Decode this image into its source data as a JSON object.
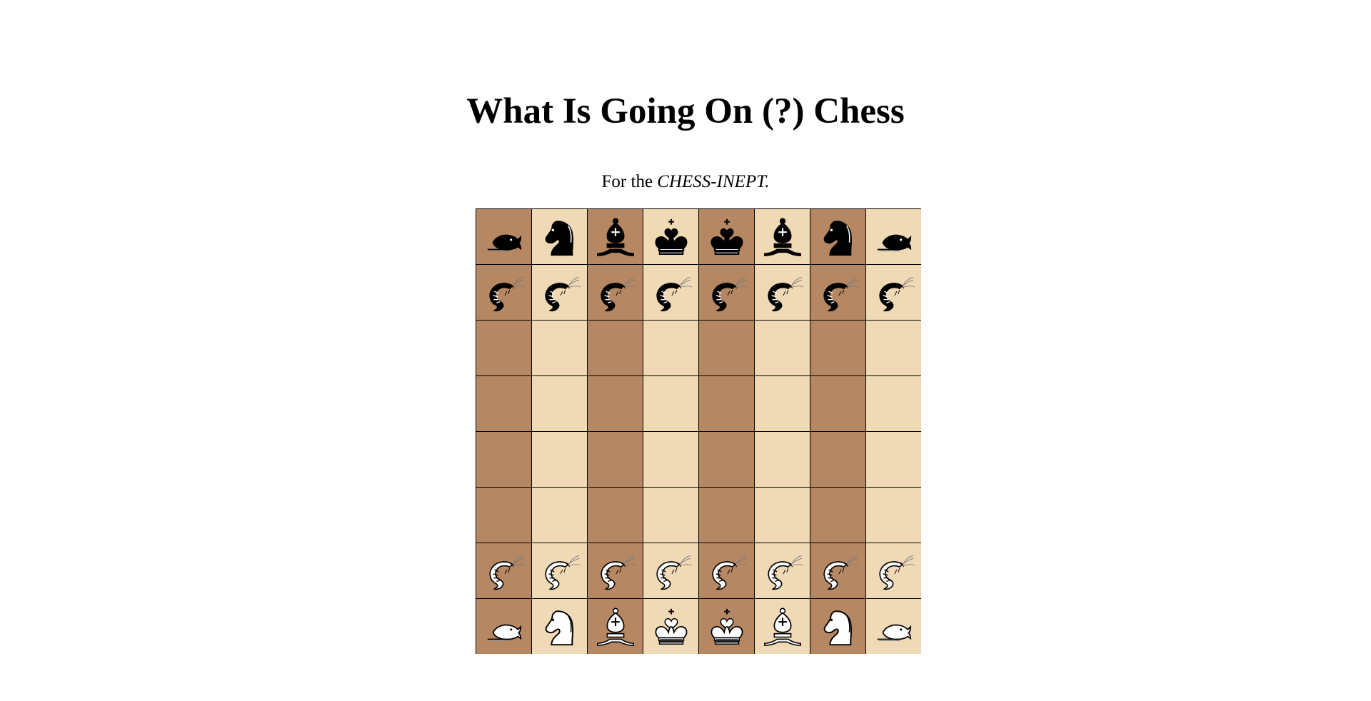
{
  "page": {
    "title": "What Is Going On (?) Chess",
    "subtitle_prefix": "For the ",
    "subtitle_emphasis": "CHESS-INEPT."
  },
  "colors": {
    "light_square": "#f0d9b5",
    "dark_square": "#b58863",
    "grid_line": "#000000"
  },
  "board": {
    "square_colors": [
      [
        "dark",
        "light",
        "dark",
        "light",
        "dark",
        "light",
        "dark",
        "light"
      ],
      [
        "dark",
        "light",
        "dark",
        "light",
        "dark",
        "light",
        "dark",
        "light"
      ],
      [
        "dark",
        "light",
        "dark",
        "light",
        "dark",
        "light",
        "dark",
        "light"
      ],
      [
        "dark",
        "light",
        "dark",
        "light",
        "dark",
        "light",
        "dark",
        "light"
      ],
      [
        "dark",
        "light",
        "dark",
        "light",
        "dark",
        "light",
        "dark",
        "light"
      ],
      [
        "dark",
        "light",
        "dark",
        "light",
        "dark",
        "light",
        "dark",
        "light"
      ],
      [
        "dark",
        "light",
        "dark",
        "light",
        "dark",
        "light",
        "dark",
        "light"
      ],
      [
        "dark",
        "light",
        "dark",
        "light",
        "dark",
        "light",
        "dark",
        "light"
      ]
    ],
    "pieces": [
      [
        "black-fish",
        "black-knight",
        "black-bishop",
        "black-king",
        "black-king",
        "black-bishop",
        "black-knight",
        "black-fish"
      ],
      [
        "black-shrimp",
        "black-shrimp",
        "black-shrimp",
        "black-shrimp",
        "black-shrimp",
        "black-shrimp",
        "black-shrimp",
        "black-shrimp"
      ],
      [
        "",
        "",
        "",
        "",
        "",
        "",
        "",
        ""
      ],
      [
        "",
        "",
        "",
        "",
        "",
        "",
        "",
        ""
      ],
      [
        "",
        "",
        "",
        "",
        "",
        "",
        "",
        ""
      ],
      [
        "",
        "",
        "",
        "",
        "",
        "",
        "",
        ""
      ],
      [
        "white-shrimp",
        "white-shrimp",
        "white-shrimp",
        "white-shrimp",
        "white-shrimp",
        "white-shrimp",
        "white-shrimp",
        "white-shrimp"
      ],
      [
        "white-fish",
        "white-knight",
        "white-bishop",
        "white-king",
        "white-king",
        "white-bishop",
        "white-knight",
        "white-fish"
      ]
    ]
  }
}
